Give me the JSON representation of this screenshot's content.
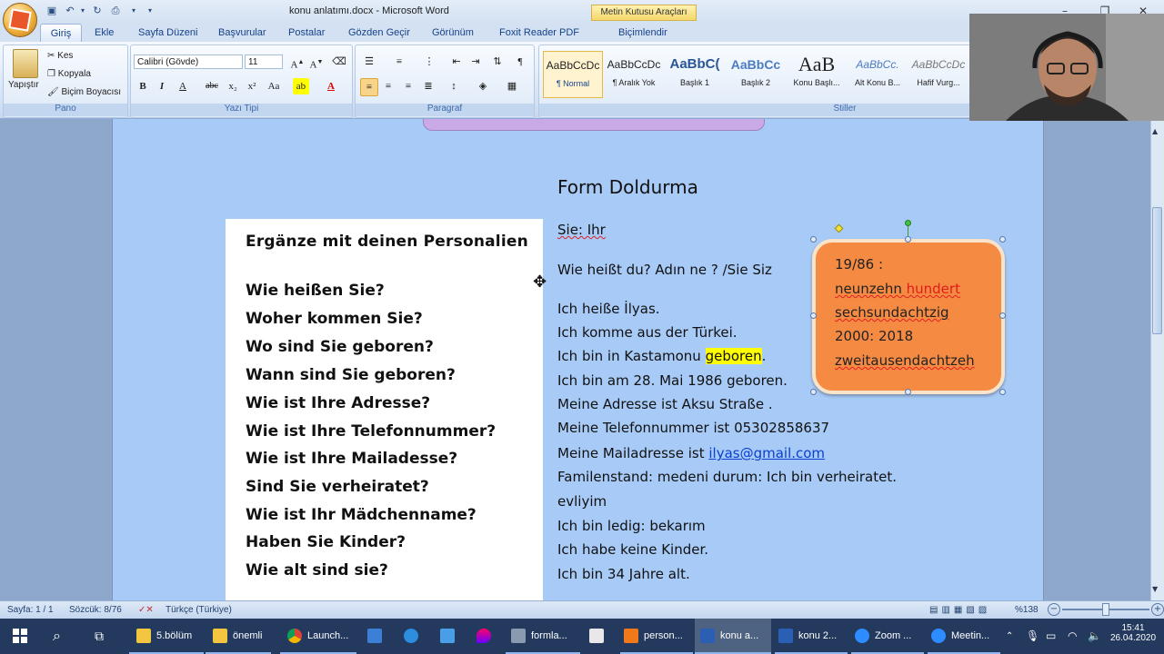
{
  "window": {
    "title": "konu anlatımı.docx - Microsoft Word",
    "contextual_tools": "Metin Kutusu Araçları"
  },
  "tabs": [
    "Giriş",
    "Ekle",
    "Sayfa Düzeni",
    "Başvurular",
    "Postalar",
    "Gözden Geçir",
    "Görünüm",
    "Foxit Reader PDF",
    "Biçimlendir"
  ],
  "ribbon": {
    "clipboard": {
      "paste": "Yapıştır",
      "cut": "Kes",
      "copy": "Kopyala",
      "format_painter": "Biçim Boyacısı",
      "label": "Pano"
    },
    "font": {
      "name": "Calibri (Gövde)",
      "size": "11",
      "label": "Yazı Tipi"
    },
    "paragraph": {
      "label": "Paragraf"
    },
    "styles": {
      "label": "Stiller",
      "items": [
        {
          "preview": "AaBbCcDc",
          "name": "¶ Normal"
        },
        {
          "preview": "AaBbCcDc",
          "name": "¶ Aralık Yok"
        },
        {
          "preview": "AaBbC(",
          "name": "Başlık 1"
        },
        {
          "preview": "AaBbCc",
          "name": "Başlık 2"
        },
        {
          "preview": "AaB",
          "name": "Konu Başlı..."
        },
        {
          "preview": "AaBbCc.",
          "name": "Alt Konu B..."
        },
        {
          "preview": "AaBbCcDc",
          "name": "Hafif Vurg..."
        }
      ]
    }
  },
  "document": {
    "heading": "Form Doldurma",
    "left_box": {
      "title": "Ergänze mit deinen Personalien",
      "questions": [
        "Wie heißen Sie?",
        "Woher kommen Sie?",
        "Wo sind Sie geboren?",
        "Wann sind Sie geboren?",
        "Wie ist Ihre Adresse?",
        "Wie ist Ihre Telefonnummer?",
        "Wie ist Ihre Mailadesse?",
        "Sind Sie verheiratet?",
        "Wie ist Ihr Mädchenname?",
        "Haben Sie Kinder?",
        "Wie alt sind sie?"
      ]
    },
    "lines": {
      "l1": "Sie: Ihr",
      "l2": "Wie heißt du? Adın ne ? /Sie Siz",
      "l3": "Ich heiße İlyas.",
      "l4": "Ich komme aus der Türkei.",
      "l5a": "Ich bin in Kastamonu ",
      "l5b": "geboren",
      "l5c": ".",
      "l6": "Ich bin am 28. Mai 1986 geboren.",
      "l7": "Meine Adresse ist Aksu Straße .",
      "l8": "Meine Telefonnummer ist 05302858637",
      "l9a": "Meine Mailadresse ist ",
      "l9b": "ilyas@gmail.com",
      "l10": "Familenstand: medeni durum: Ich bin verheiratet.",
      "l11": "evliyim",
      "l12": "Ich bin ledig: bekarım",
      "l13": "Ich habe keine Kinder.",
      "l14": "Ich bin 34 Jahre alt."
    },
    "textbox": {
      "l1": "19/86 :",
      "l2a": "neunzehn ",
      "l2b": "hundert",
      "l3": "sechsundachtzig",
      "l4": "2000: 2018",
      "l5": "zweitausendachtzeh"
    }
  },
  "status": {
    "page": "Sayfa: 1 / 1",
    "words": "Sözcük: 8/76",
    "language": "Türkçe (Türkiye)",
    "zoom": "%138"
  },
  "taskbar": {
    "items": [
      "5.bölüm",
      "önemli",
      "Launch...",
      "formla...",
      "person...",
      "konu a...",
      "konu 2...",
      "Zoom ...",
      "Meetin..."
    ],
    "time": "15:41",
    "date": "26.04.2020"
  },
  "colors": {
    "page_bg": "#a7caf7",
    "textbox_fill": "#f58b43",
    "highlight": "#ffff00",
    "ribbon_accent": "#15428b"
  }
}
